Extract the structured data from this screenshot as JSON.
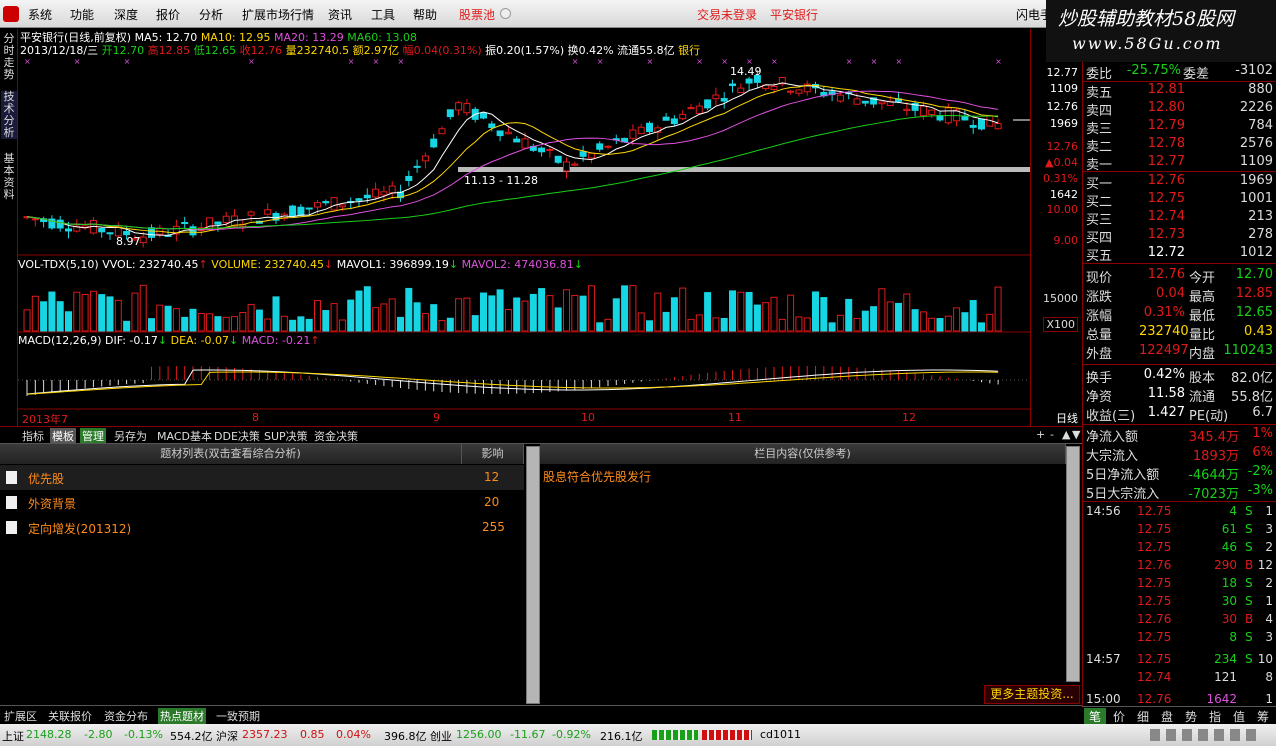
{
  "menubar": {
    "items": [
      "系统",
      "功能",
      "深度",
      "报价",
      "分析",
      "扩展市场行情",
      "资讯",
      "工具",
      "帮助"
    ],
    "pool": "股票池",
    "login_status": "交易未登录",
    "stock_name": "平安银行",
    "flash_label": "闪电手"
  },
  "brand": {
    "line1": "炒股辅助教材58股网",
    "line2": "www.58Gu.com"
  },
  "left_tabs": [
    "分时走势",
    "技术分析",
    "基本资料"
  ],
  "kline": {
    "header": "平安银行(日线,前复权)",
    "ma5": "MA5: 12.70",
    "ma10": "MA10: 12.95",
    "ma20": "MA20: 13.29",
    "ma60": "MA60: 13.08",
    "info_date": "2013/12/18/三",
    "info_open": "开12.70",
    "info_high": "高12.85",
    "info_low": "低12.65",
    "info_close": "收12.76",
    "info_vol": "量232740.5",
    "info_amt": "额2.97亿",
    "info_chg": "幅0.04(0.31%)",
    "info_amp": "振0.20(1.57%)",
    "info_turn": "换0.42%",
    "info_float": "流通55.8亿",
    "info_sector": "银行",
    "label_high": "14.49",
    "label_low": "8.97",
    "label_range": "11.13 - 11.28",
    "axis_right": [
      {
        "label": "12.77",
        "color": "#ffffff"
      },
      {
        "label": "1109",
        "color": "#ffffff"
      },
      {
        "label": "12.76",
        "color": "#ffffff"
      },
      {
        "label": "1969",
        "color": "#ffffff"
      },
      {
        "label": "12.76",
        "color": "#e01a1a"
      },
      {
        "label": "▲0.04",
        "color": "#e01a1a"
      },
      {
        "label": "0.31%",
        "color": "#e01a1a"
      },
      {
        "label": "1642",
        "color": "#ffffff"
      },
      {
        "label": "10.00",
        "color": "#e01a1a"
      },
      {
        "label": "9.00",
        "color": "#e01a1a"
      }
    ]
  },
  "volume": {
    "header": "VOL-TDX(5,10)",
    "vvol": "VVOL: 232740.45",
    "volume": "VOLUME: 232740.45",
    "mavol1": "MAVOL1: 396899.19",
    "mavol2": "MAVOL2: 474036.81",
    "axis_label": "15000",
    "unit": "X100"
  },
  "macd": {
    "header": "MACD(12,26,9)",
    "dif": "DIF: -0.17",
    "dea": "DEA: -0.07",
    "macd": "MACD: -0.21"
  },
  "xaxis": {
    "labels": [
      "2013年7",
      "8",
      "9",
      "10",
      "11",
      "12"
    ],
    "period": "日线"
  },
  "toolstrip": {
    "buttons": [
      "指标",
      "模板",
      "管理",
      "另存为",
      "MACD基本",
      "DDE决策",
      "SUP决策",
      "资金决策"
    ],
    "zoom": [
      "+",
      "-",
      "▲",
      "▼"
    ]
  },
  "topics": {
    "col1": "题材列表(双击查看综合分析)",
    "col2": "影响",
    "col3": "栏目内容(仅供参考)",
    "rows": [
      {
        "name": "优先股",
        "impact": "12"
      },
      {
        "name": "外资背景",
        "impact": "20"
      },
      {
        "name": "定向增发(201312)",
        "impact": "255"
      }
    ],
    "content": "股息符合优先股发行",
    "more": "更多主题投资..."
  },
  "bottom_tabs": [
    "扩展区",
    "关联报价",
    "资金分布",
    "热点题材",
    "一致预期"
  ],
  "statusbar": {
    "sh_label": "上证",
    "sh_val": "2148.28",
    "sh_chg": "-2.80",
    "sh_pct": "-0.13%",
    "sh_amt": "554.2亿",
    "sz_label": "沪深",
    "sz_val": "2357.23",
    "sz_chg": "0.85",
    "sz_pct": "0.04%",
    "sz_amt": "396.8亿",
    "cy_label": "创业",
    "cy_val": "1256.00",
    "cy_chg": "-11.67",
    "cy_pct": "-0.92%",
    "cy_amt": "216.1亿",
    "code": "cd1011"
  },
  "quote": {
    "webi_label": "委比",
    "webi_val": "-25.75%",
    "wecha_label": "委差",
    "wecha_val": "-3102",
    "asks": [
      {
        "label": "卖五",
        "price": "12.81",
        "vol": "880"
      },
      {
        "label": "卖四",
        "price": "12.80",
        "vol": "2226"
      },
      {
        "label": "卖三",
        "price": "12.79",
        "vol": "784"
      },
      {
        "label": "卖二",
        "price": "12.78",
        "vol": "2576"
      },
      {
        "label": "卖一",
        "price": "12.77",
        "vol": "1109"
      }
    ],
    "bids": [
      {
        "label": "买一",
        "price": "12.76",
        "vol": "1969"
      },
      {
        "label": "买二",
        "price": "12.75",
        "vol": "1001"
      },
      {
        "label": "买三",
        "price": "12.74",
        "vol": "213"
      },
      {
        "label": "买四",
        "price": "12.73",
        "vol": "278"
      },
      {
        "label": "买五",
        "price": "12.72",
        "vol": "1012"
      }
    ],
    "stats": [
      {
        "l1": "现价",
        "v1": "12.76",
        "c1": "#e01a1a",
        "l2": "今开",
        "v2": "12.70",
        "c2": "#18d018"
      },
      {
        "l1": "涨跌",
        "v1": "0.04",
        "c1": "#e01a1a",
        "l2": "最高",
        "v2": "12.85",
        "c2": "#e01a1a"
      },
      {
        "l1": "涨幅",
        "v1": "0.31%",
        "c1": "#e01a1a",
        "l2": "最低",
        "v2": "12.65",
        "c2": "#18d018"
      },
      {
        "l1": "总量",
        "v1": "232740",
        "c1": "#ffd700",
        "l2": "量比",
        "v2": "0.43",
        "c2": "#ffd700"
      },
      {
        "l1": "外盘",
        "v1": "122497",
        "c1": "#e01a1a",
        "l2": "内盘",
        "v2": "110243",
        "c2": "#18d018"
      }
    ],
    "stats2": [
      {
        "l1": "换手",
        "v1": "0.42%",
        "l2": "股本",
        "v2": "82.0亿"
      },
      {
        "l1": "净资",
        "v1": "11.58",
        "l2": "流通",
        "v2": "55.8亿"
      },
      {
        "l1": "收益(三)",
        "v1": "1.427",
        "l2": "PE(动)",
        "v2": "6.7"
      }
    ],
    "flows": [
      {
        "label": "净流入额",
        "val": "345.4万",
        "pct": "1%",
        "color": "#e01a1a"
      },
      {
        "label": "大宗流入",
        "val": "1893万",
        "pct": "6%",
        "color": "#e01a1a"
      },
      {
        "label": "5日净流入额",
        "val": "-4644万",
        "pct": "-2%",
        "color": "#18d018"
      },
      {
        "label": "5日大宗流入",
        "val": "-7023万",
        "pct": "-3%",
        "color": "#18d018"
      }
    ],
    "ticks": [
      {
        "time": "14:56",
        "price": "12.75",
        "vol": "4",
        "bs": "S",
        "n": "1"
      },
      {
        "time": "",
        "price": "12.75",
        "vol": "61",
        "bs": "S",
        "n": "3"
      },
      {
        "time": "",
        "price": "12.75",
        "vol": "46",
        "bs": "S",
        "n": "2"
      },
      {
        "time": "",
        "price": "12.76",
        "vol": "290",
        "bs": "B",
        "n": "12"
      },
      {
        "time": "",
        "price": "12.75",
        "vol": "18",
        "bs": "S",
        "n": "2"
      },
      {
        "time": "",
        "price": "12.75",
        "vol": "30",
        "bs": "S",
        "n": "1"
      },
      {
        "time": "",
        "price": "12.76",
        "vol": "30",
        "bs": "B",
        "n": "4"
      },
      {
        "time": "",
        "price": "12.75",
        "vol": "8",
        "bs": "S",
        "n": "3"
      },
      {
        "time": "14:57",
        "price": "12.75",
        "vol": "234",
        "bs": "S",
        "n": "10"
      },
      {
        "time": "",
        "price": "12.74",
        "vol": "121",
        "bs": "",
        "n": "8"
      },
      {
        "time": "15:00",
        "price": "12.76",
        "vol": "1642",
        "bs": "",
        "n": "1"
      }
    ],
    "tabs": [
      "笔",
      "价",
      "细",
      "盘",
      "势",
      "指",
      "值",
      "筹"
    ]
  },
  "colors": {
    "up": "#e01a1a",
    "down": "#16d6e4",
    "ma5": "#ffffff",
    "ma10": "#ffd700",
    "ma20": "#e050e0",
    "ma60": "#18d018",
    "border": "#8a0000"
  }
}
